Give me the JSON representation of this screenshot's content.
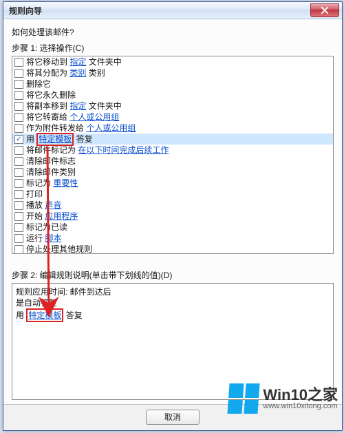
{
  "window": {
    "title": "规则向导"
  },
  "prompt": "如何处理该邮件?",
  "step1": {
    "label": "步骤 1: 选择操作(C)",
    "items": [
      {
        "checked": false,
        "pre": "将它移动到 ",
        "link": "指定",
        "post": " 文件夹中"
      },
      {
        "checked": false,
        "pre": "将其分配为 ",
        "link": "类别",
        "post": " 类别"
      },
      {
        "checked": false,
        "pre": "删除它",
        "link": "",
        "post": ""
      },
      {
        "checked": false,
        "pre": "将它永久删除",
        "link": "",
        "post": ""
      },
      {
        "checked": false,
        "pre": "将副本移到 ",
        "link": "指定",
        "post": " 文件夹中"
      },
      {
        "checked": false,
        "pre": "将它转寄给 ",
        "link": "个人或公用组",
        "post": ""
      },
      {
        "checked": false,
        "pre": "作为附件转发给 ",
        "link": "个人或公用组",
        "post": ""
      },
      {
        "checked": true,
        "pre": "用 ",
        "link": "特定模板",
        "post": " 答复"
      },
      {
        "checked": false,
        "pre": "将邮件标记为 ",
        "link": "在以下时间完成后续工作",
        "post": ""
      },
      {
        "checked": false,
        "pre": "清除邮件标志",
        "link": "",
        "post": ""
      },
      {
        "checked": false,
        "pre": "清除邮件类别",
        "link": "",
        "post": ""
      },
      {
        "checked": false,
        "pre": "标记为 ",
        "link": "重要性",
        "post": ""
      },
      {
        "checked": false,
        "pre": "打印",
        "link": "",
        "post": ""
      },
      {
        "checked": false,
        "pre": "播放 ",
        "link": "声音",
        "post": ""
      },
      {
        "checked": false,
        "pre": "开始 ",
        "link": "应用程序",
        "post": ""
      },
      {
        "checked": false,
        "pre": "标记为已读",
        "link": "",
        "post": ""
      },
      {
        "checked": false,
        "pre": "运行 ",
        "link": "脚本",
        "post": ""
      },
      {
        "checked": false,
        "pre": "停止处理其他规则",
        "link": "",
        "post": ""
      }
    ]
  },
  "step2": {
    "label": "步骤 2: 编辑规则说明(单击带下划线的值)(D)",
    "line1": "规则应用时间: 邮件到达后",
    "line2": "是自动答复",
    "line3_pre": "用 ",
    "line3_link": "特定模板",
    "line3_post": " 答复"
  },
  "buttons": {
    "cancel": "取消"
  },
  "watermark": {
    "big": "Win10之家",
    "small": "www.win10xitong.com"
  }
}
